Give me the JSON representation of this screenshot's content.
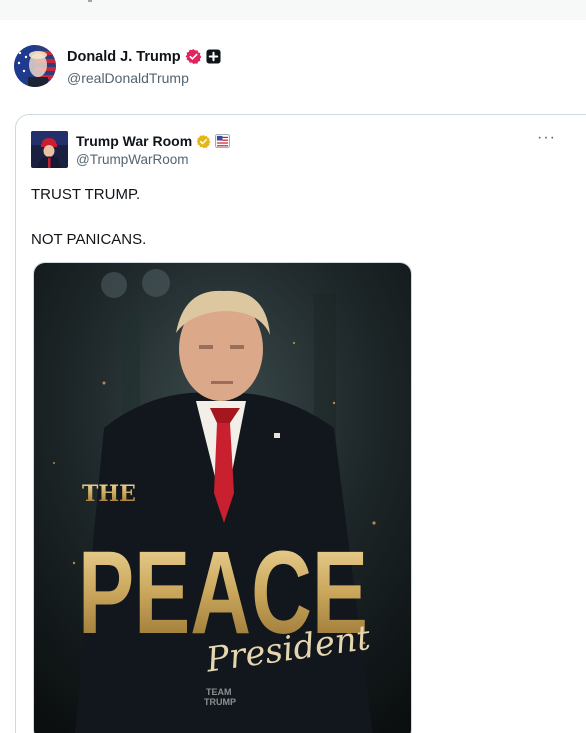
{
  "post": {
    "display_name": "Donald J. Trump",
    "handle": "@realDonaldTrump",
    "verified_badge": "verified-badge-icon",
    "affiliate_badge": "plus-square-icon"
  },
  "quote": {
    "display_name": "Trump War Room",
    "handle": "@TrumpWarRoom",
    "text_line1": "TRUST TRUMP.",
    "text_line2": "NOT PANICANS.",
    "more_label": "···",
    "media": {
      "overlay_the": "THE",
      "overlay_peace": "PEACE",
      "overlay_president": "President",
      "watermark_line1": "TEAM",
      "watermark_line2": "TRUMP"
    }
  },
  "colors": {
    "verified_pink": "#e0245e",
    "verified_gold": "#e2b719",
    "gold_text": "#c9a65b",
    "handle_gray": "#536471",
    "border": "#cfd9de"
  }
}
